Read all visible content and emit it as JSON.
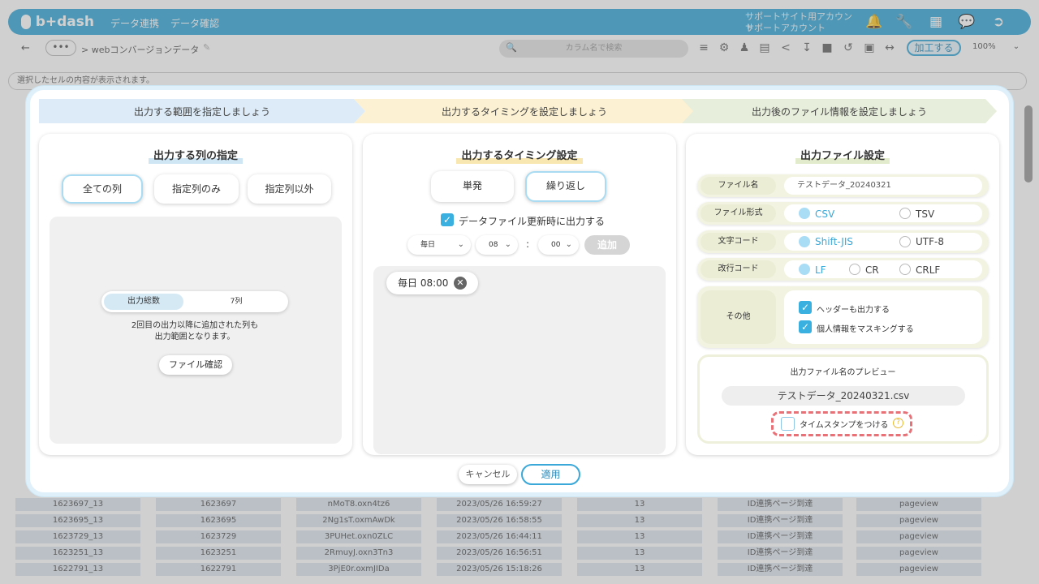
{
  "app": {
    "logo": "b+dash",
    "nav": [
      "データ連携",
      "データ確認"
    ],
    "account_line1": "サポートサイト用アカウント",
    "account_line2": "サポートアカウント"
  },
  "toolbar": {
    "breadcrumb": "> webコンバージョンデータ",
    "dots": "•••",
    "search_placeholder": "カラム名で検索",
    "process_button": "加工する",
    "zoom": "100%"
  },
  "selection_bar": "選択したセルの内容が表示されます。",
  "steps": [
    "出力する範囲を指定しましょう",
    "出力するタイミングを設定しましょう",
    "出力後のファイル情報を設定しましょう"
  ],
  "left": {
    "title": "出力する列の指定",
    "buttons": [
      "全ての列",
      "指定列のみ",
      "指定列以外"
    ],
    "active": 0,
    "sum_label": "出力総数",
    "sum_value": "7列",
    "note_line1": "2回目の出力以降に追加された列も",
    "note_line2": "出力範囲となります。",
    "file_check": "ファイル確認"
  },
  "middle": {
    "title": "出力するタイミング設定",
    "buttons": [
      "単発",
      "繰り返し"
    ],
    "active": 1,
    "update_checkbox": "データファイル更新時に出力する",
    "freq": "毎日",
    "hour": "08",
    "colon": ":",
    "minute": "00",
    "add": "追加",
    "chip": "毎日 08:00"
  },
  "right": {
    "title": "出力ファイル設定",
    "filename_label": "ファイル名",
    "filename_value": "テストデータ_20240321",
    "format_label": "ファイル形式",
    "format_options": [
      "CSV",
      "TSV"
    ],
    "charset_label": "文字コード",
    "charset_options": [
      "Shift-JIS",
      "UTF-8"
    ],
    "newline_label": "改行コード",
    "newline_options": [
      "LF",
      "CR",
      "CRLF"
    ],
    "other_label": "その他",
    "other_checks": [
      "ヘッダーも出力する",
      "個人情報をマスキングする"
    ],
    "preview_title": "出力ファイル名のプレビュー",
    "preview_name": "テストデータ_20240321.csv",
    "timestamp_label": "タイムスタンプをつける",
    "help": "?"
  },
  "footer": {
    "cancel": "キャンセル",
    "apply": "適用"
  },
  "table": {
    "rows": [
      [
        "1623697_13",
        "1623697",
        "nMoT8.oxn4tz6",
        "2023/05/26 16:59:27",
        "13",
        "ID連携ページ到達",
        "pageview"
      ],
      [
        "1623695_13",
        "1623695",
        "2Ng1sT.oxmAwDk",
        "2023/05/26 16:58:55",
        "13",
        "ID連携ページ到達",
        "pageview"
      ],
      [
        "1623729_13",
        "1623729",
        "3PUHet.oxn0ZLC",
        "2023/05/26 16:44:11",
        "13",
        "ID連携ページ到達",
        "pageview"
      ],
      [
        "1623251_13",
        "1623251",
        "2RmuyJ.oxn3Tn3",
        "2023/05/26 16:56:51",
        "13",
        "ID連携ページ到達",
        "pageview"
      ],
      [
        "1622791_13",
        "1622791",
        "3PjE0r.oxmJIDa",
        "2023/05/26 15:18:26",
        "13",
        "ID連携ページ到達",
        "pageview"
      ]
    ]
  }
}
